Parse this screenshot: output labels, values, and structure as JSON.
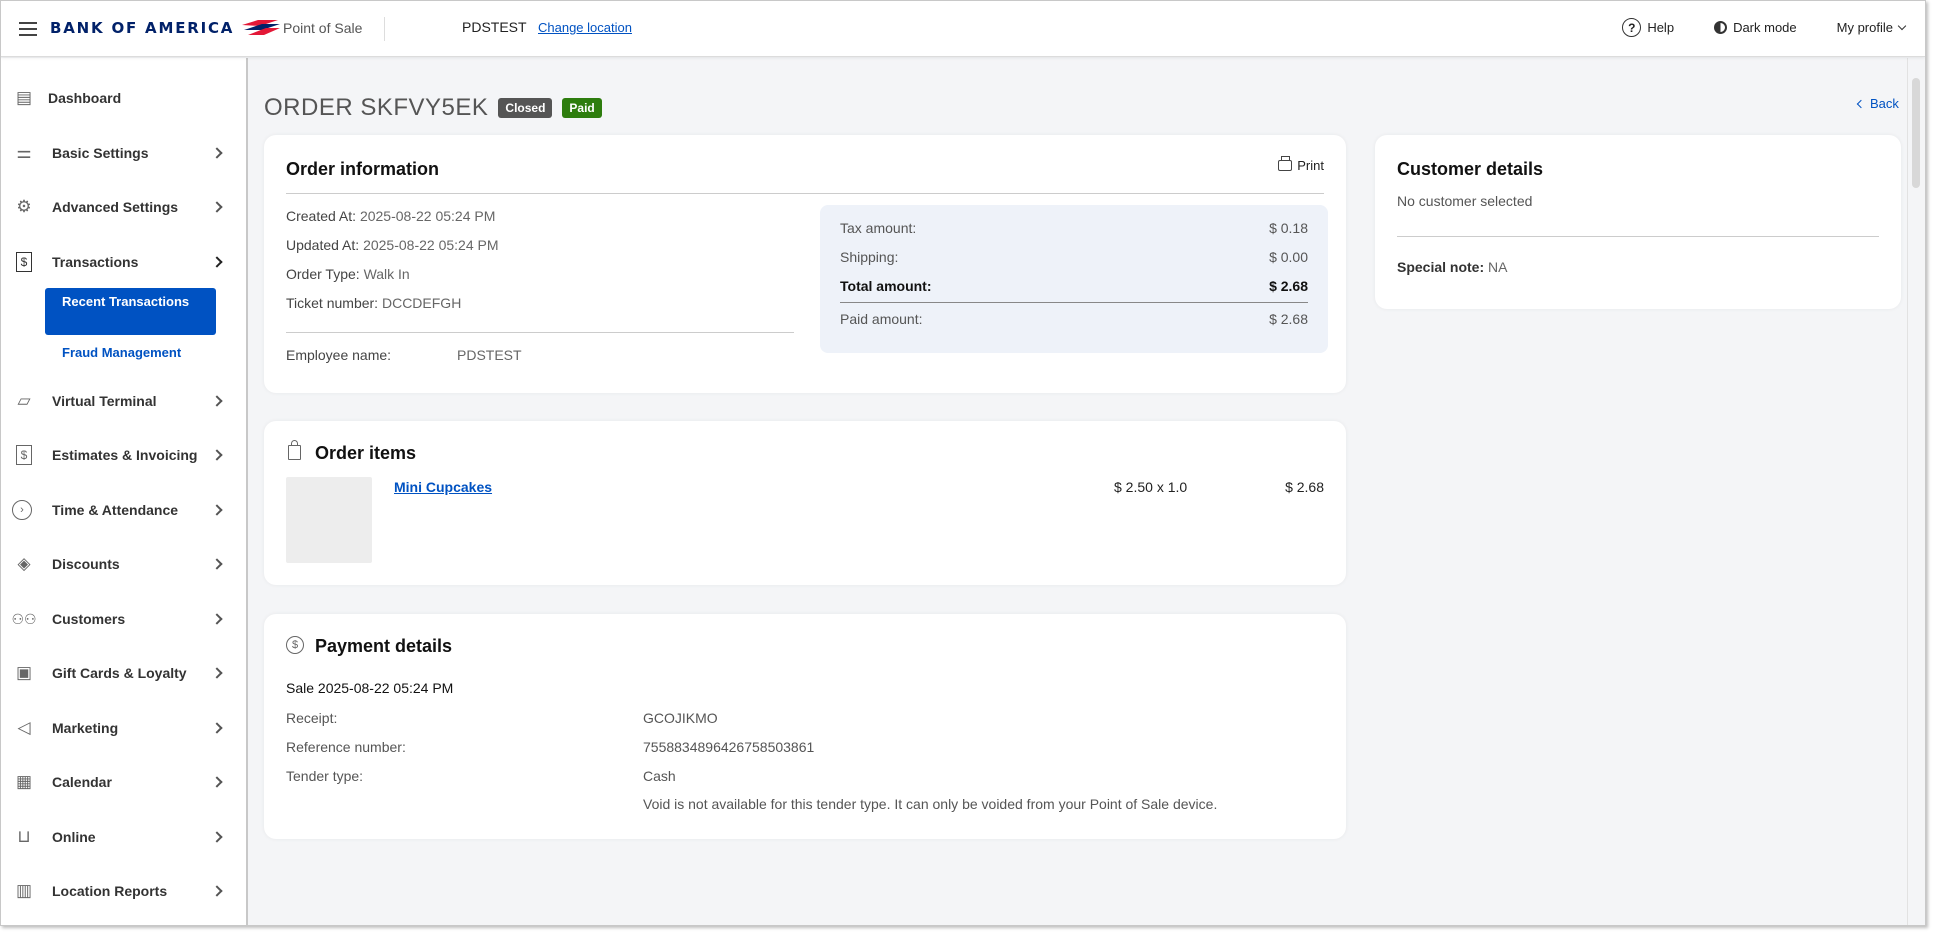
{
  "header": {
    "brand": "BANK OF AMERICA",
    "app_name": "Point of Sale",
    "location": "PDSTEST",
    "change_location": "Change location",
    "help": "Help",
    "dark_mode": "Dark mode",
    "profile": "My profile",
    "brand_color": "#012169",
    "accent_color": "#0052c2"
  },
  "sidebar": {
    "items": [
      {
        "label": "Dashboard",
        "icon": "dashboard-icon"
      },
      {
        "label": "Basic Settings",
        "icon": "sliders-icon"
      },
      {
        "label": "Advanced Settings",
        "icon": "gear-icon"
      },
      {
        "label": "Transactions",
        "icon": "dollar-doc-icon"
      },
      {
        "label": "Virtual Terminal",
        "icon": "terminal-icon"
      },
      {
        "label": "Estimates & Invoicing",
        "icon": "invoice-icon"
      },
      {
        "label": "Time & Attendance",
        "icon": "clock-icon"
      },
      {
        "label": "Discounts",
        "icon": "tag-icon"
      },
      {
        "label": "Customers",
        "icon": "users-icon"
      },
      {
        "label": "Gift Cards & Loyalty",
        "icon": "gift-card-icon"
      },
      {
        "label": "Marketing",
        "icon": "megaphone-icon"
      },
      {
        "label": "Calendar",
        "icon": "calendar-icon"
      },
      {
        "label": "Online",
        "icon": "cart-icon"
      },
      {
        "label": "Location Reports",
        "icon": "bar-chart-icon"
      }
    ],
    "sub_items": {
      "recent": "Recent Transactions",
      "fraud": "Fraud Management"
    }
  },
  "order": {
    "title": "ORDER SKFVY5EK",
    "status_closed": "Closed",
    "status_paid": "Paid",
    "back": "Back"
  },
  "order_info": {
    "title": "Order information",
    "print": "Print",
    "created_label": "Created At:",
    "created_value": "2025-08-22 05:24 PM",
    "updated_label": "Updated At:",
    "updated_value": "2025-08-22 05:24 PM",
    "type_label": "Order Type:",
    "type_value": "Walk In",
    "ticket_label": "Ticket number:",
    "ticket_value": "DCCDEFGH",
    "employee_label": "Employee name:",
    "employee_value": "PDSTEST",
    "tax_label": "Tax amount:",
    "tax_value": "$ 0.18",
    "shipping_label": "Shipping:",
    "shipping_value": "$ 0.00",
    "total_label": "Total amount:",
    "total_value": "$ 2.68",
    "paid_label": "Paid amount:",
    "paid_value": "$ 2.68"
  },
  "order_items": {
    "title": "Order items",
    "items": [
      {
        "name": "Mini Cupcakes",
        "qty": "$ 2.50 x 1.0",
        "total": "$ 2.68"
      }
    ]
  },
  "payment": {
    "title": "Payment details",
    "sale": "Sale 2025-08-22 05:24 PM",
    "receipt_label": "Receipt:",
    "receipt_value": "GCOJIKMO",
    "reference_label": "Reference number:",
    "reference_value": "7558834896426758503861",
    "tender_label": "Tender type:",
    "tender_value": "Cash",
    "void_note": "Void is not available for this tender type. It can only be voided from your Point of Sale device."
  },
  "customer": {
    "title": "Customer details",
    "none": "No customer selected",
    "special_label": "Special note:",
    "special_value": "NA"
  }
}
